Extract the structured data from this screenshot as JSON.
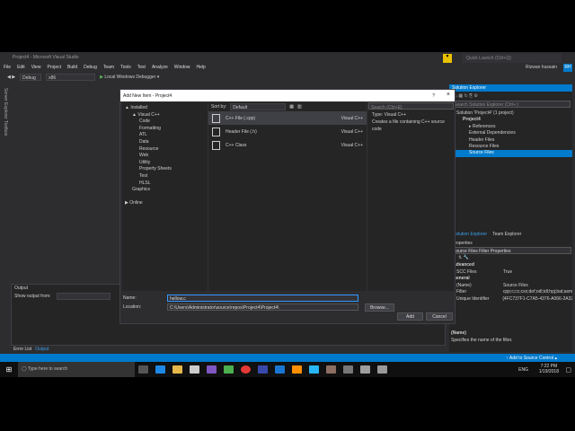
{
  "window": {
    "title": "Project4 - Microsoft Visual Studio",
    "quick_launch": "Quick Launch (Ctrl+Q)",
    "user": "Rizwan hussain",
    "initials": "RH"
  },
  "menu": [
    "File",
    "Edit",
    "View",
    "Project",
    "Build",
    "Debug",
    "Team",
    "Tools",
    "Test",
    "Analyze",
    "Window",
    "Help"
  ],
  "toolbar": {
    "config": "Debug",
    "platform": "x86",
    "debugger": "Local Windows Debugger"
  },
  "side_tabs": [
    "Server Explorer",
    "Toolbox"
  ],
  "dialog": {
    "title": "Add New Item - Project4",
    "help": "?",
    "close": "×",
    "tree": [
      {
        "label": "▲ Installed",
        "lvl": 0
      },
      {
        "label": "▲ Visual C++",
        "lvl": 1
      },
      {
        "label": "Code",
        "lvl": 2
      },
      {
        "label": "Formatting",
        "lvl": 2
      },
      {
        "label": "ATL",
        "lvl": 2
      },
      {
        "label": "Data",
        "lvl": 2
      },
      {
        "label": "Resource",
        "lvl": 2
      },
      {
        "label": "Web",
        "lvl": 2
      },
      {
        "label": "Utility",
        "lvl": 2
      },
      {
        "label": "Property Sheets",
        "lvl": 2
      },
      {
        "label": "Test",
        "lvl": 2
      },
      {
        "label": "HLSL",
        "lvl": 2
      },
      {
        "label": "Graphics",
        "lvl": 1
      },
      {
        "label": "",
        "lvl": 0
      },
      {
        "label": "▶ Online",
        "lvl": 0
      }
    ],
    "sort_label": "Sort by:",
    "sort_value": "Default",
    "search_placeholder": "Search (Ctrl+E)",
    "items": [
      {
        "name": "C++ File (.cpp)",
        "type": "Visual C++",
        "icon": "cpp-file-icon"
      },
      {
        "name": "Header File (.h)",
        "type": "Visual C++",
        "icon": "header-file-icon"
      },
      {
        "name": "C++ Class",
        "type": "Visual C++",
        "icon": "class-icon"
      }
    ],
    "info_type": "Type: Visual C++",
    "info_desc": "Creates a file containing C++ source code",
    "name_label": "Name:",
    "name_value": "hellow.c",
    "location_label": "Location:",
    "location_value": "C:\\Users\\Administrator\\source\\repos\\Project4\\Project4\\",
    "browse": "Browse...",
    "add": "Add",
    "cancel": "Cancel"
  },
  "solution_explorer": {
    "title": "Solution Explorer",
    "search": "Search Solution Explorer (Ctrl+;)",
    "rows": [
      {
        "label": "Solution 'Project4' (1 project)",
        "lvl": 0
      },
      {
        "label": "Project4",
        "lvl": 1
      },
      {
        "label": "▸ References",
        "lvl": 2
      },
      {
        "label": "External Dependencies",
        "lvl": 2
      },
      {
        "label": "Header Files",
        "lvl": 2
      },
      {
        "label": "Resource Files",
        "lvl": 2
      },
      {
        "label": "Source Files",
        "lvl": 2,
        "selected": true
      }
    ],
    "tabs": [
      "Solution Explorer",
      "Team Explorer"
    ]
  },
  "properties": {
    "title": "Properties",
    "object": "Source Files  Filter Properties",
    "rows": [
      {
        "cat": "Advanced"
      },
      {
        "k": "SCC Files",
        "v": "True"
      },
      {
        "cat": "General"
      },
      {
        "k": "(Name)",
        "v": "Source Files"
      },
      {
        "k": "Filter",
        "v": "cpp;c;cc;cxx;def;odl;idl;hpj;bat;asm"
      },
      {
        "k": "Unique Identifier",
        "v": "{4FC737F1-C7A5-4376-A066-2A32"
      }
    ],
    "desc_title": "(Name)",
    "desc": "Specifies the name of the filter."
  },
  "output": {
    "title": "Output",
    "show_from": "Show output from:",
    "tabs": [
      "Error List",
      "Output"
    ]
  },
  "status": {
    "source_control": "↑ Add to Source Control ▴"
  },
  "taskbar": {
    "search": "Type here to search",
    "time": "7:22 PM",
    "date": "1/19/2018",
    "lang": "ENG"
  },
  "colors": {
    "accent": "#007acc",
    "background": "#2d2d30"
  }
}
